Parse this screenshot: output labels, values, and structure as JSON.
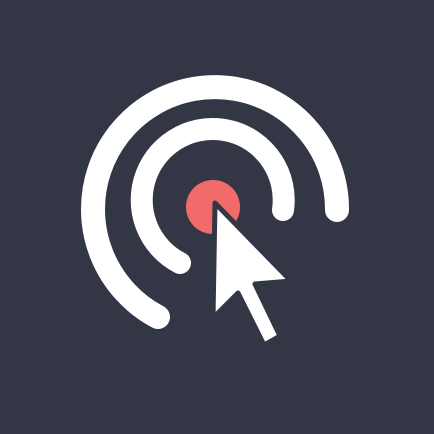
{
  "icon": {
    "name": "click-target-cursor-icon",
    "colors": {
      "background": "#333745",
      "rings": "#ffffff",
      "target_dot": "#f26b6b",
      "cursor": "#ffffff"
    }
  }
}
